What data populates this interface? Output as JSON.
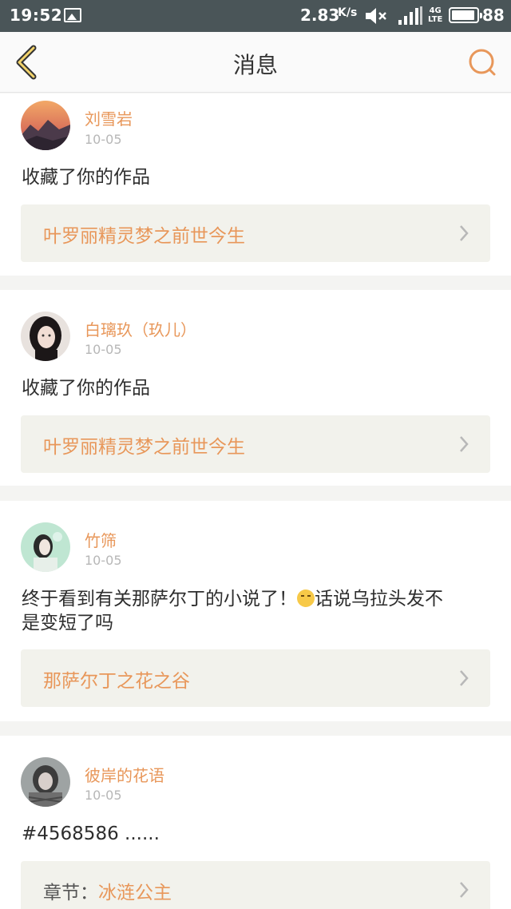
{
  "status_bar": {
    "time": "19:52",
    "speed": "2.83",
    "speed_unit": "K/s",
    "network": "4G",
    "network_sub": "LTE",
    "battery": "88",
    "icons": [
      "image-icon",
      "mute-icon",
      "signal-icon",
      "battery-icon"
    ]
  },
  "nav": {
    "title": "消息",
    "back_icon": "chevron-left-icon",
    "search_icon": "search-icon",
    "accent_color": "#e8975a"
  },
  "messages": [
    {
      "user": "刘雪岩",
      "date": "10-05",
      "text": "收藏了你的作品",
      "link_prefix": "",
      "link": "叶罗丽精灵梦之前世今生"
    },
    {
      "user": "白璃玖（玖儿）",
      "date": "10-05",
      "text": "收藏了你的作品",
      "link_prefix": "",
      "link": "叶罗丽精灵梦之前世今生"
    },
    {
      "user": "竹筛",
      "date": "10-05",
      "text_line1_before": "终于看到有关那萨尔丁的小说了！",
      "text_line1_after": "话说乌拉头发不",
      "text_line2": "是变短了吗",
      "emoji": "crying-face-emoji",
      "link_prefix": "",
      "link": "那萨尔丁之花之谷"
    },
    {
      "user": "彼岸的花语",
      "date": "10-05",
      "text": "#4568586 ......",
      "link_prefix": "章节：",
      "link": "冰涟公主"
    }
  ]
}
